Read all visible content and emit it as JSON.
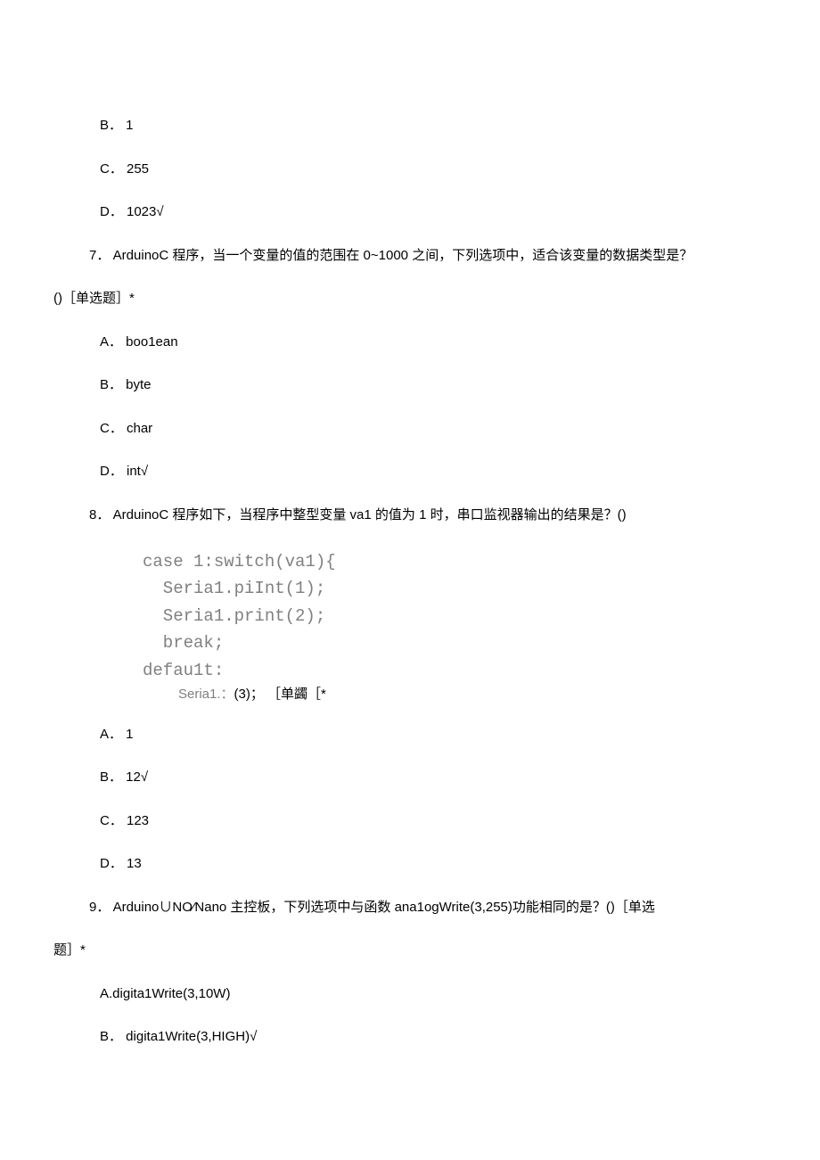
{
  "top_options": {
    "b": "B． 1",
    "c": "C． 255",
    "d": "D． 1023√"
  },
  "q7": {
    "line1": "7． ArduinoC 程序，当一个变量的值的范围在 0~1000 之间，下列选项中，适合该变量的数据类型是？",
    "line2": "()［单选题］*",
    "a": "A． boo1ean",
    "b": "B． byte",
    "c": "C． char",
    "d": "D． int√"
  },
  "q8": {
    "stem": "8． ArduinoC 程序如下，当程序中整型变量 va1 的值为 1 时，串口监视器输出的结果是？()",
    "code1": "case 1:switch(va1){",
    "code2": "  Seria1.piInt(1);",
    "code3": "  Seria1.print(2);",
    "code4": "  break;",
    "code5": "defau1t:",
    "code6_prefix": "Seria1.：",
    "code6_rest": "(3)； ［单蠲［*",
    "a": "A． 1",
    "b": "B． 12√",
    "c": "C． 123",
    "d": "D． 13"
  },
  "q9": {
    "line1": "9． Arduino∪NO⁄Nano 主控板，下列选项中与函数 ana1ogWrite(3,255)功能相同的是？()［单选",
    "line2": "题］*",
    "a": "A.digita1Write(3,10W)",
    "b": "B． digita1Write(3,HIGH)√"
  }
}
